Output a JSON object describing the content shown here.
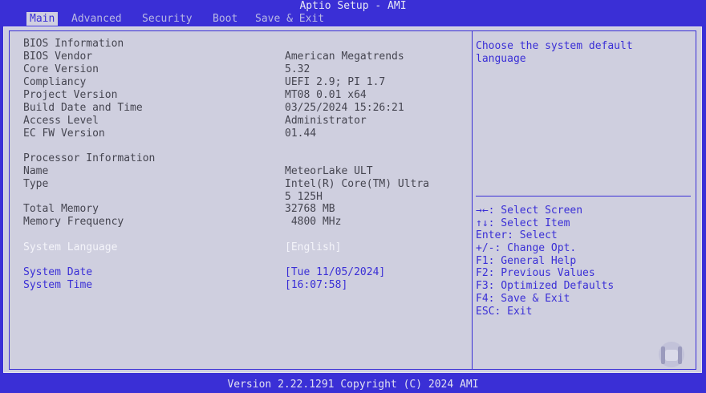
{
  "window": {
    "title": "Aptio Setup - AMI"
  },
  "tabs": [
    {
      "label": "Main",
      "active": true
    },
    {
      "label": "Advanced"
    },
    {
      "label": "Security"
    },
    {
      "label": "Boot"
    },
    {
      "label": "Save & Exit"
    }
  ],
  "main": {
    "bios_info": {
      "heading": "BIOS Information",
      "rows": [
        {
          "label": "BIOS Vendor",
          "value": "American Megatrends"
        },
        {
          "label": "Core Version",
          "value": "5.32"
        },
        {
          "label": "Compliancy",
          "value": "UEFI 2.9; PI 1.7"
        },
        {
          "label": "Project Version",
          "value": "MT08 0.01 x64"
        },
        {
          "label": "Build Date and Time",
          "value": "03/25/2024 15:26:21"
        },
        {
          "label": "Access Level",
          "value": "Administrator"
        },
        {
          "label": "EC FW Version",
          "value": "01.44"
        }
      ]
    },
    "processor_info": {
      "heading": "Processor Information",
      "name_label": "Name",
      "name_value": "MeteorLake ULT",
      "type_label": "Type",
      "type_value_line1": "Intel(R) Core(TM) Ultra",
      "type_value_line2": "5 125H",
      "memory_label": "Total Memory",
      "memory_value": "32768 MB",
      "freq_label": "Memory Frequency",
      "freq_value": " 4800 MHz"
    },
    "settings": {
      "language_label": "System Language",
      "language_value": "[English]",
      "date_label": "System Date",
      "date_value": "[Tue 11/05/2024]",
      "time_label": "System Time",
      "time_value": "[16:07:58]"
    }
  },
  "help": {
    "text": "Choose the system default\nlanguage"
  },
  "keys": [
    "→←: Select Screen",
    "↑↓: Select Item",
    "Enter: Select",
    "+/-: Change Opt.",
    "F1: General Help",
    "F2: Previous Values",
    "F3: Optimized Defaults",
    "F4: Save & Exit",
    "ESC: Exit"
  ],
  "footer": {
    "text": "Version 2.22.1291 Copyright (C) 2024 AMI"
  },
  "colors": {
    "background": "#3a2fd6",
    "panel": "#cfcfdf",
    "text": "#454550",
    "accent": "#3a2fd6"
  }
}
